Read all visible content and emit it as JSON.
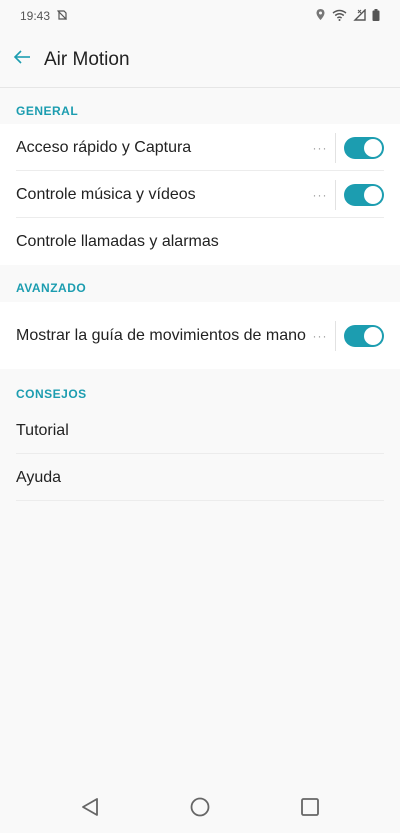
{
  "status_bar": {
    "time": "19:43",
    "icons": [
      "do-not-disturb-icon",
      "location-icon",
      "wifi-icon",
      "signal-icon",
      "battery-icon"
    ]
  },
  "app_bar": {
    "title": "Air Motion",
    "back_icon": "arrow-left-icon"
  },
  "sections": [
    {
      "header": "GENERAL",
      "items": [
        {
          "label": "Acceso rápido y Captura",
          "has_more": true,
          "more_glyph": "···",
          "toggle_on": true
        },
        {
          "label": "Controle música y vídeos",
          "has_more": true,
          "more_glyph": "···",
          "toggle_on": true
        },
        {
          "label": "Controle llamadas y alarmas",
          "has_more": false,
          "toggle_on": null
        }
      ]
    },
    {
      "header": "AVANZADO",
      "items": [
        {
          "label": "Mostrar la guía de movimientos de mano",
          "has_more": true,
          "more_glyph": "···",
          "toggle_on": true
        }
      ]
    },
    {
      "header": "CONSEJOS",
      "items": [
        {
          "label": "Tutorial"
        },
        {
          "label": "Ayuda"
        }
      ]
    }
  ],
  "nav_bar": {
    "icons": [
      "back-triangle-icon",
      "home-circle-icon",
      "recents-square-icon"
    ]
  },
  "colors": {
    "accent": "#1c9db0",
    "background": "#f9f9f9",
    "card": "#ffffff",
    "text": "#222222"
  }
}
